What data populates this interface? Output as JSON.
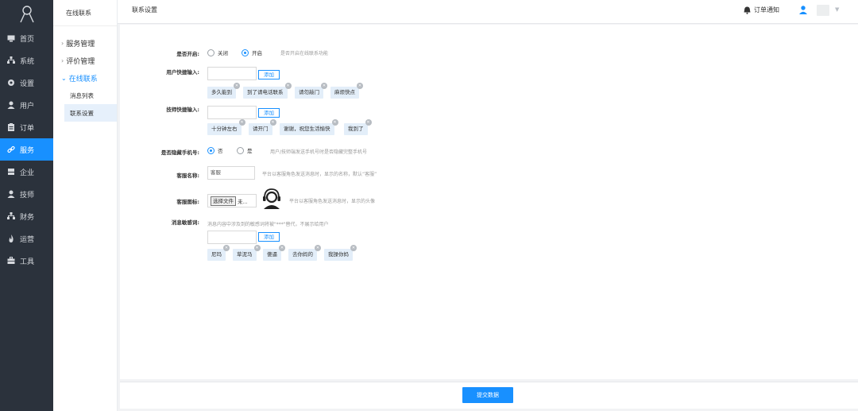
{
  "nav": {
    "items": [
      {
        "label": "首页",
        "icon": "monitor-icon"
      },
      {
        "label": "系统",
        "icon": "sitemap-icon"
      },
      {
        "label": "设置",
        "icon": "gear-icon"
      },
      {
        "label": "用户",
        "icon": "user-icon"
      },
      {
        "label": "订单",
        "icon": "clipboard-icon"
      },
      {
        "label": "服务",
        "icon": "link-icon"
      },
      {
        "label": "企业",
        "icon": "building-icon"
      },
      {
        "label": "技师",
        "icon": "user-icon"
      },
      {
        "label": "财务",
        "icon": "sitemap-icon"
      },
      {
        "label": "运营",
        "icon": "fire-icon"
      },
      {
        "label": "工具",
        "icon": "briefcase-icon"
      }
    ],
    "active_index": 5
  },
  "subnav": {
    "title": "在线联系",
    "groups": [
      {
        "label": "服务管理"
      },
      {
        "label": "评价管理"
      },
      {
        "label": "在线联系"
      }
    ],
    "leaves": [
      {
        "label": "消息列表"
      },
      {
        "label": "联系设置"
      }
    ]
  },
  "header": {
    "title": "联系设置",
    "notification": "订单通知"
  },
  "form": {
    "enabled": {
      "label": "是否开启:",
      "options": [
        "关闭",
        "开启"
      ],
      "selected": "开启",
      "hint": "是否开启在线联系功能"
    },
    "user_quick": {
      "label": "用户快捷输入:",
      "input_value": "",
      "add_label": "添加",
      "tags": [
        "多久能到",
        "到了请电话联系",
        "请勿敲门",
        "麻烦快点"
      ]
    },
    "tech_quick": {
      "label": "技师快捷输入:",
      "input_value": "",
      "add_label": "添加",
      "tags": [
        "十分钟左右",
        "请开门",
        "谢谢，祝您生活愉快",
        "我到了"
      ]
    },
    "hide_phone": {
      "label": "是否隐藏手机号:",
      "options": [
        "否",
        "是"
      ],
      "selected": "否",
      "hint": "用户/技师端发送手机号时是否隐藏完整手机号"
    },
    "service_name": {
      "label": "客服名称:",
      "value": "客服",
      "hint": "平台以客服角色发送消息时，显示的名称，默认“客服”"
    },
    "service_icon": {
      "label": "客服图标:",
      "file_button": "选择文件",
      "file_status": "未...",
      "hint": "平台以客服角色发送消息时，显示的头像"
    },
    "sensitive": {
      "label": "消息敏感词:",
      "hint": "消息内容中涉及到的敏感词将被\"***\"替代，不展示给用户",
      "input_value": "",
      "add_label": "添加",
      "tags": [
        "尼玛",
        "草泥马",
        "傻逼",
        "去你妈的",
        "我操你妈"
      ]
    }
  },
  "footer": {
    "submit_label": "提交数据"
  },
  "colors": {
    "nav_bg": "#2b323c",
    "accent": "#1890ff",
    "tag_bg": "#e3eef9"
  }
}
